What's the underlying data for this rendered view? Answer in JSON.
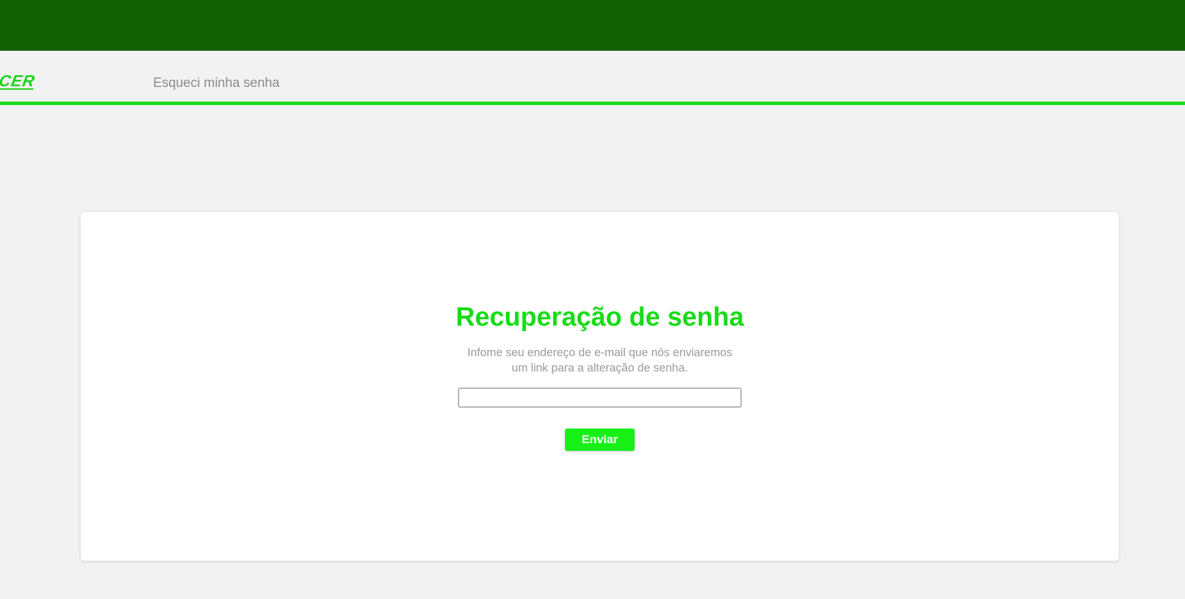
{
  "header": {
    "logo_text": "OCCER",
    "page_title": "Esqueci minha senha"
  },
  "recovery": {
    "title": "Recuperação de senha",
    "description_line1": "Infome seu endereço de e-mail que nós enviaremos",
    "description_line2": "um link para a alteração de senha.",
    "email_value": "",
    "submit_label": "Enviar"
  },
  "colors": {
    "top_bar": "#116104",
    "accent": "#1edc1e",
    "button": "#17f017",
    "title": "#17dc17"
  }
}
